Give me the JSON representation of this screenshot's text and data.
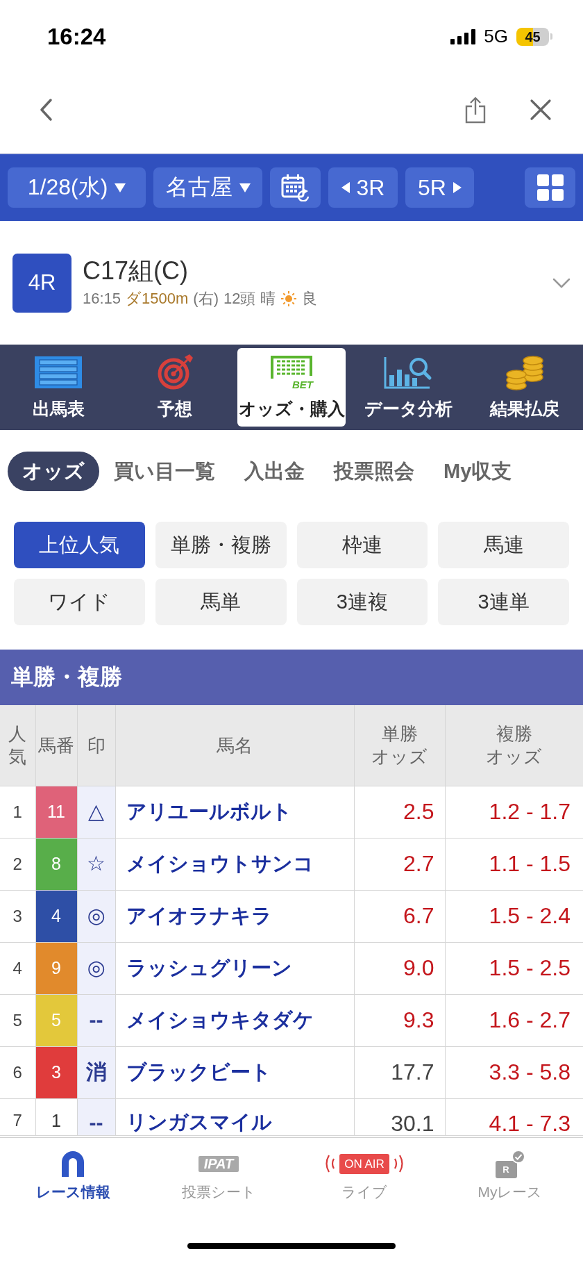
{
  "status_bar": {
    "time": "16:24",
    "network": "5G",
    "battery": "45"
  },
  "race_nav": {
    "date": "1/28(水)",
    "venue": "名古屋",
    "prev_race": "3R",
    "next_race": "5R"
  },
  "race": {
    "number": "4R",
    "title": "C17組(C)",
    "start_time": "16:15",
    "course": "ダ1500m",
    "direction": "(右)",
    "runners": "12頭",
    "weather": "晴",
    "condition": "良"
  },
  "menu_tabs": [
    {
      "label": "出馬表",
      "selected": false
    },
    {
      "label": "予想",
      "selected": false
    },
    {
      "label": "オッズ・購入",
      "icon_text": "BET",
      "selected": true
    },
    {
      "label": "データ分析",
      "selected": false
    },
    {
      "label": "結果払戻",
      "selected": false
    }
  ],
  "sub_tabs": [
    {
      "label": "オッズ",
      "selected": true
    },
    {
      "label": "買い目一覧",
      "selected": false
    },
    {
      "label": "入出金",
      "selected": false
    },
    {
      "label": "投票照会",
      "selected": false
    },
    {
      "label": "My収支",
      "selected": false
    }
  ],
  "bet_types": [
    {
      "label": "上位人気",
      "selected": true
    },
    {
      "label": "単勝・複勝",
      "selected": false
    },
    {
      "label": "枠連",
      "selected": false
    },
    {
      "label": "馬連",
      "selected": false
    },
    {
      "label": "ワイド",
      "selected": false
    },
    {
      "label": "馬単",
      "selected": false
    },
    {
      "label": "3連複",
      "selected": false
    },
    {
      "label": "3連単",
      "selected": false
    }
  ],
  "odds": {
    "title": "単勝・複勝",
    "columns": [
      "人気",
      "馬番",
      "印",
      "馬名",
      "単勝オッズ",
      "複勝オッズ"
    ],
    "rows": [
      {
        "rank": "1",
        "number": "11",
        "color": "#df6279",
        "mark": "△",
        "name": "アリユールボルト",
        "win_odds": "2.5",
        "win_highlight": true,
        "place_odds": "1.2 - 1.7",
        "place_highlight": true
      },
      {
        "rank": "2",
        "number": "8",
        "color": "#58ae4a",
        "mark": "☆",
        "name": "メイショウトサンコ",
        "win_odds": "2.7",
        "win_highlight": true,
        "place_odds": "1.1 - 1.5",
        "place_highlight": true
      },
      {
        "rank": "3",
        "number": "4",
        "color": "#2e4fa6",
        "mark": "◎",
        "name": "アイオラナキラ",
        "win_odds": "6.7",
        "win_highlight": true,
        "place_odds": "1.5 - 2.4",
        "place_highlight": true
      },
      {
        "rank": "4",
        "number": "9",
        "color": "#e18a2c",
        "mark": "◎",
        "name": "ラッシュグリーン",
        "win_odds": "9.0",
        "win_highlight": true,
        "place_odds": "1.5 - 2.5",
        "place_highlight": true
      },
      {
        "rank": "5",
        "number": "5",
        "color": "#e3c83b",
        "mark": "--",
        "name": "メイショウキタダケ",
        "win_odds": "9.3",
        "win_highlight": true,
        "place_odds": "1.6 - 2.7",
        "place_highlight": true
      },
      {
        "rank": "6",
        "number": "3",
        "color": "#e03c3c",
        "mark": "消",
        "name": "ブラックビート",
        "win_odds": "17.7",
        "win_highlight": false,
        "place_odds": "3.3 - 5.8",
        "place_highlight": true
      },
      {
        "rank": "7",
        "number": "1",
        "color": "#ffffff",
        "mark": "--",
        "name": "リンガスマイル",
        "win_odds": "30.1",
        "win_highlight": false,
        "place_odds": "4.1 - 7.3",
        "place_highlight": true
      }
    ]
  },
  "bottom_nav": [
    {
      "label": "レース情報",
      "selected": true
    },
    {
      "label": "投票シート",
      "badge": "IPAT",
      "selected": false
    },
    {
      "label": "ライブ",
      "badge": "ON AIR",
      "selected": false
    },
    {
      "label": "Myレース",
      "badge": "R",
      "selected": false
    }
  ]
}
